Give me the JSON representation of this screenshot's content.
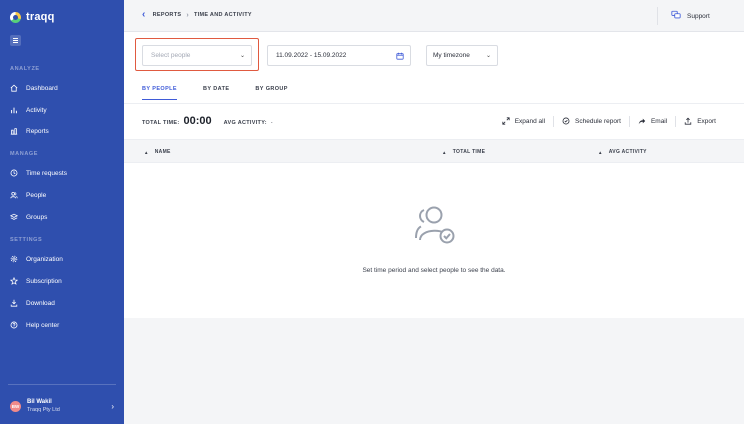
{
  "app": {
    "name": "traqq"
  },
  "sidebar": {
    "sections": [
      {
        "label": "ANALYZE"
      },
      {
        "label": "MANAGE"
      },
      {
        "label": "SETTINGS"
      }
    ],
    "items": [
      {
        "label": "Dashboard",
        "icon": "home-icon"
      },
      {
        "label": "Activity",
        "icon": "bar-chart-icon"
      },
      {
        "label": "Reports",
        "icon": "reports-icon"
      },
      {
        "label": "Time requests",
        "icon": "clock-icon"
      },
      {
        "label": "People",
        "icon": "users-icon"
      },
      {
        "label": "Groups",
        "icon": "layers-icon"
      },
      {
        "label": "Organization",
        "icon": "gear-icon"
      },
      {
        "label": "Subscription",
        "icon": "star-icon"
      },
      {
        "label": "Download",
        "icon": "download-icon"
      },
      {
        "label": "Help center",
        "icon": "help-icon"
      }
    ],
    "user": {
      "initials": "BW",
      "name": "Bil Wakil",
      "org": "Traqq Pty Ltd"
    }
  },
  "header": {
    "breadcrumb": [
      "REPORTS",
      "TIME AND ACTIVITY"
    ],
    "support_label": "Support"
  },
  "filters": {
    "people_placeholder": "Select people",
    "date_range": "11.09.2022 - 15.09.2022",
    "timezone": "My timezone"
  },
  "tabs": [
    {
      "label": "BY PEOPLE",
      "active": true
    },
    {
      "label": "BY DATE",
      "active": false
    },
    {
      "label": "BY GROUP",
      "active": false
    }
  ],
  "totals": {
    "total_time_label": "TOTAL TIME:",
    "total_time_value": "00:00",
    "avg_activity_label": "AVG ACTIVITY:",
    "avg_activity_value": "-"
  },
  "actions": {
    "expand_all": "Expand all",
    "schedule_report": "Schedule report",
    "email": "Email",
    "export": "Export"
  },
  "table": {
    "columns": [
      "NAME",
      "TOTAL TIME",
      "AVG ACTIVITY"
    ]
  },
  "empty_state": {
    "message": "Set time period and select people to see the data."
  },
  "colors": {
    "sidebar_bg": "#2f4fae",
    "accent": "#3f5bd8",
    "highlight_border": "#e05a40"
  }
}
